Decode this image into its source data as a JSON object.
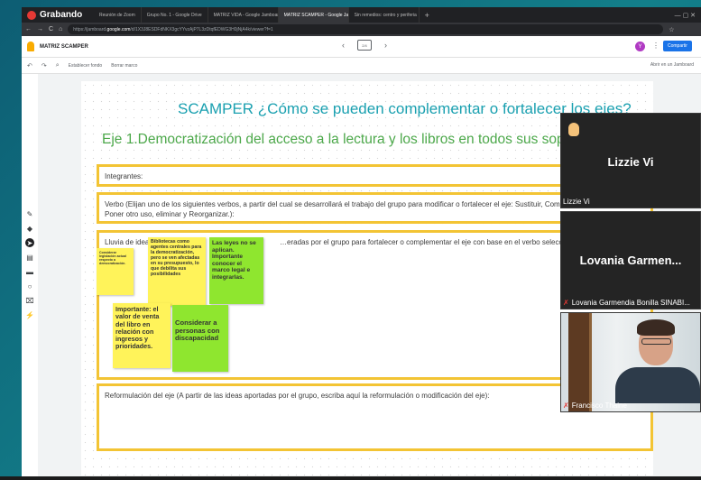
{
  "recording": {
    "label": "Grabando"
  },
  "browser": {
    "tabs": [
      {
        "label": "Reunión de Zoom",
        "active": false
      },
      {
        "label": "Grupo No. 1 - Google Drive",
        "active": false
      },
      {
        "label": "MATRIZ VIDA - Google Jamboard",
        "active": false
      },
      {
        "label": "MATRIZ SCAMPER - Google Jamboard",
        "active": true
      },
      {
        "label": "Sin remedios: centro y periferia",
        "active": false
      }
    ],
    "new_tab": "+",
    "window_controls": "— ▢ ✕",
    "url_prefix": "https://jamboard.",
    "url_domain": "google.com",
    "url_rest": "/d/1X3J8ESDFdNKX3gcYYvzAjP7L3zDtqfEDWG3H0jNjA4k/viewer?f=1"
  },
  "app": {
    "title": "MATRIZ SCAMPER",
    "frame_indicator": "2/4",
    "avatar_letter": "Y",
    "share_label": "Compartir",
    "toolbar_set_background": "Establecer fondo",
    "toolbar_clear_frame": "Borrar marco",
    "open_in_app": "Abrir en un Jamboard"
  },
  "board": {
    "title": "SCAMPER  ¿Cómo se pueden complementar o fortalecer los ejes?",
    "eje": "Eje 1.Democratización del acceso a la lectura y los libros en todos sus soportes",
    "integrantes": "Integrantes:",
    "verbo": "Verbo (Elijan uno de los siguientes verbos, a partir del cual se desarrollará el trabajo del grupo para modificar o fortalecer el eje: Sustituir, Combinar, Adaptar, Modificar, Poner otro uso, eliminar y Reorganizar.):",
    "lluvia_start": "Lluvia de ideas",
    "lluvia_end": "…eradas por el grupo para fortalecer o complementar el eje con base en el verbo seleccionado):",
    "reformulacion": "Reformulación del eje (A partir de las ideas aportadas por el grupo, escriba aquí la reformulación o modificación del eje):",
    "stickies": [
      {
        "text": "Considerar legislación actual respecto a democratización.",
        "color": "yellow"
      },
      {
        "text": "Bibliotecas como agentes centrales para la democratización, pero se ven afectadas en su presupuesto, lo que debilita sus posibilidades",
        "color": "yellow"
      },
      {
        "text": "Las leyes no se aplican. Importante conocer el marco legal e integrarlas.",
        "color": "green"
      },
      {
        "text": "Importante: el valor de venta del libro en relación con ingresos y prioridades.",
        "color": "yellow"
      },
      {
        "text": "Considerar a personas con discapacidad",
        "color": "green"
      }
    ]
  },
  "video": {
    "participants": [
      {
        "big_name": "Lizzie Vi",
        "label": "Lizzie Vi",
        "hand_raised": true,
        "muted": false
      },
      {
        "big_name": "Lovania  Garmen...",
        "label": "Lovania Garmendia Bonilla SINABI...",
        "muted": true
      },
      {
        "label": "Francisco Thaine",
        "muted": true
      }
    ]
  }
}
